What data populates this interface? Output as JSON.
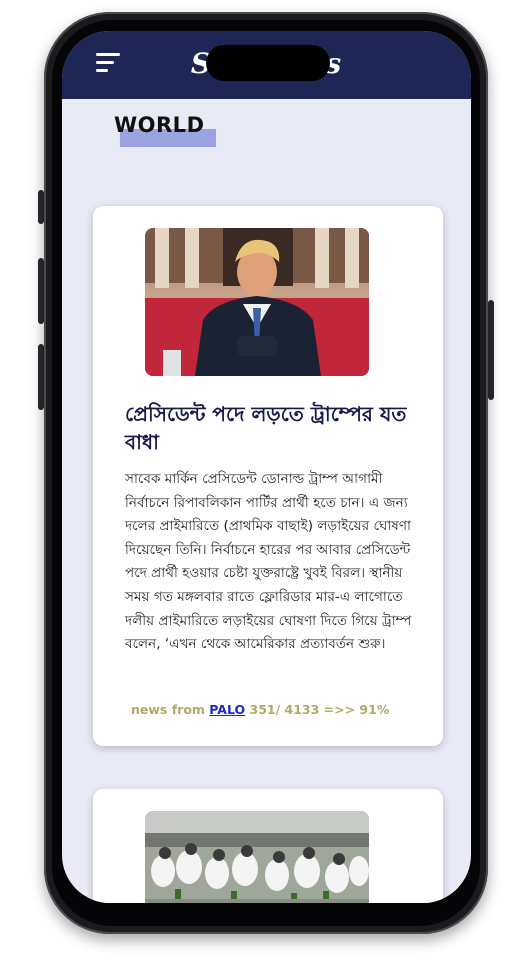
{
  "app": {
    "title": "SunNews"
  },
  "section": {
    "title": "WORLD"
  },
  "articles": [
    {
      "headline": "প্রেসিডেন্ট পদে লড়তে ট্রাম্পের যত বাধা",
      "body": "সাবেক মার্কিন প্রেসিডেন্ট ডোনাল্ড ট্রাম্প আগামী নির্বাচনে রিপাবলিকান পার্টির প্রার্থী হতে চান। এ জন্য দলের প্রাইমারিতে (প্রাথমিক বাছাই) লড়াইয়ের ঘোষণা দিয়েছেন তিনি। নির্বাচনে হারের পর আবার প্রেসিডেন্ট পদে প্রার্থী হওয়ার চেষ্টা যুক্তরাষ্ট্রে খুবই বিরল। স্থানীয় সময় গত মঙ্গলবার রাতে ফ্লোরিডার মার-এ লাগোতে দলীয় প্রাইমারিতে লড়াইয়ের ঘোষণা দিতে গিয়ে ট্রাম্প বলেন, ‘এখন থেকে আমেরিকার প্রত্যাবর্তন শুরু।",
      "source_prefix": "news from",
      "source_name": "PALO",
      "stats": "351/ 4133 =>> 91%"
    }
  ],
  "colors": {
    "header": "#1e2656",
    "background": "#e8eaf5",
    "accent": "#9aa3df",
    "link": "#1b2bd0",
    "meta": "#b0aa6a"
  },
  "icons": [
    "menu-icon"
  ]
}
